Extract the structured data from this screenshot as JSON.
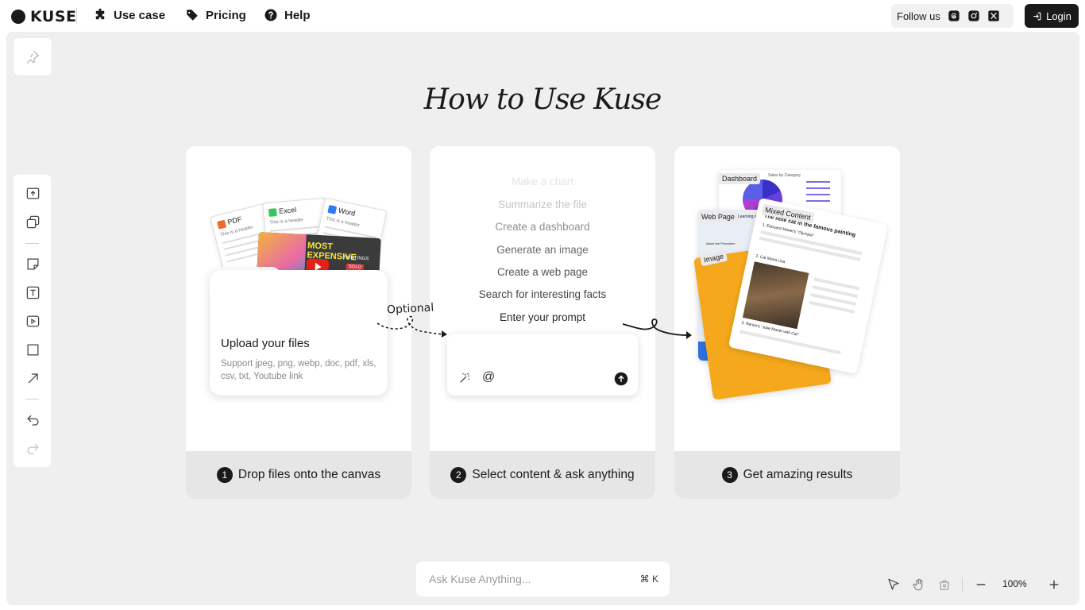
{
  "nav": {
    "logo": "KUSE",
    "items": [
      {
        "label": "Use case",
        "icon": "puzzle-icon"
      },
      {
        "label": "Pricing",
        "icon": "tag-icon"
      },
      {
        "label": "Help",
        "icon": "help-icon"
      }
    ],
    "follow_label": "Follow us",
    "social": [
      "threads-icon",
      "instagram-icon",
      "x-icon"
    ],
    "login_label": "Login"
  },
  "canvas": {
    "title": "How to Use Kuse",
    "cards": [
      {
        "step": "1",
        "caption": "Drop files onto the canvas",
        "docs": [
          "PDF",
          "Excel",
          "Word"
        ],
        "doc_header": "This is a header",
        "poster_text": "MOST EXPENSIVE",
        "poster_sub": "PAINTINGS",
        "poster_tag": "SOLD",
        "upload_title": "Upload your files",
        "upload_sub": "Support jpeg, png, webp, doc, pdf, xls, csv, txt, Youtube link"
      },
      {
        "step": "2",
        "caption": "Select content & ask anything",
        "prompts": [
          "Make a chart",
          "Summarize the file",
          "Create a dashboard",
          "Generate an image",
          "Create a web page",
          "Search for interesting facts",
          "Enter your prompt"
        ]
      },
      {
        "step": "3",
        "caption": "Get amazing results",
        "labels": {
          "dashboard": "Dashboard",
          "webpage": "Web Page",
          "image": "Image",
          "mixed": "Mixed Content"
        },
        "mixed_title": "The little cat in the famous painting",
        "mixed_items": [
          "1. Edouard Manet's \"Olympia\"",
          "2. Cat Mona Lisa",
          "3. Renoir's \"Julie Manet with Cat\""
        ],
        "dashboard_title": "Sales by Category",
        "webpage_text": "Learning w",
        "webpage_sub": "About the Promotion"
      }
    ],
    "optional_label": "Optional"
  },
  "ask": {
    "placeholder": "Ask Kuse Anything...",
    "shortcut": "⌘ K"
  },
  "zoom": "100%"
}
